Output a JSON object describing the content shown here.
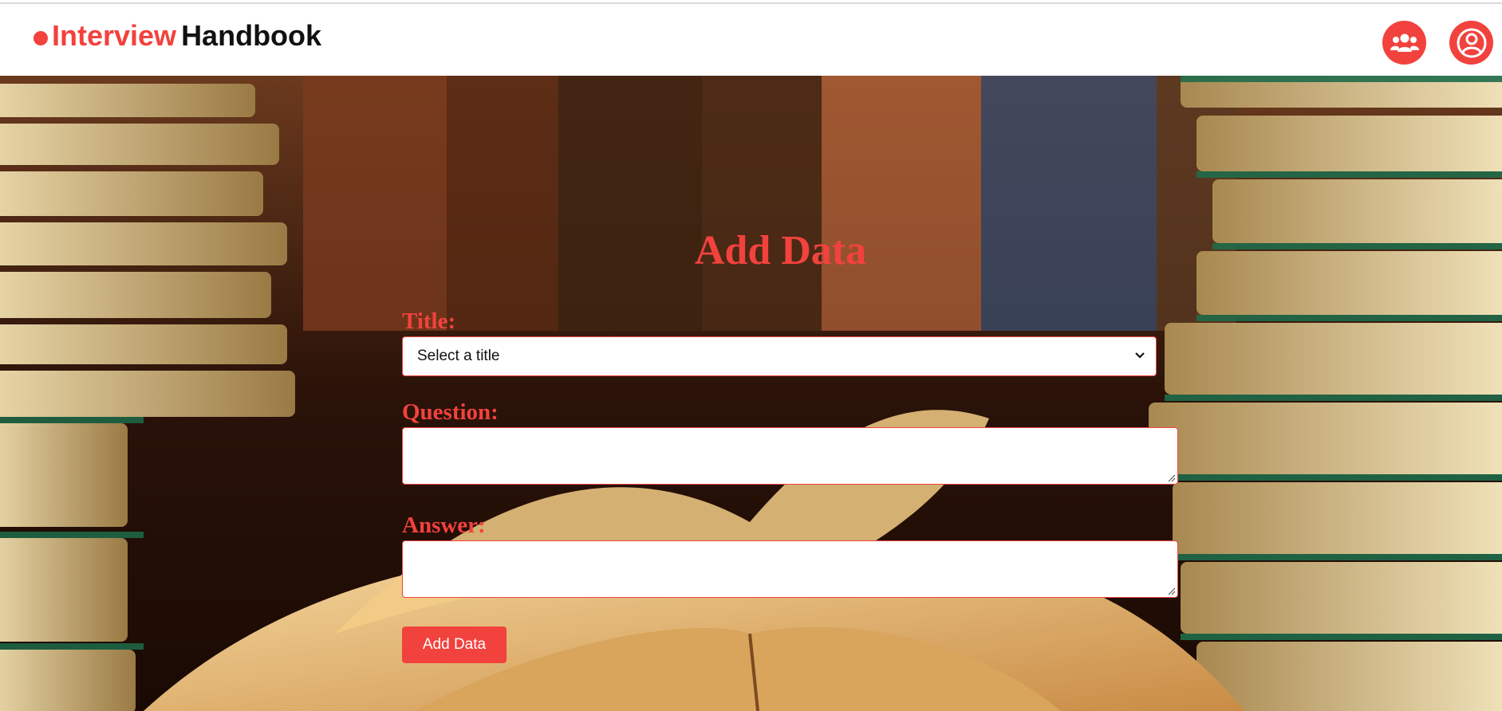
{
  "brand": {
    "part1": "Interview",
    "part2": "Handbook"
  },
  "nav": {
    "icons": [
      {
        "name": "users-group-icon"
      },
      {
        "name": "user-circle-icon"
      }
    ]
  },
  "form": {
    "heading": "Add Data",
    "title_label": "Title:",
    "title_select_value": "Select a title",
    "question_label": "Question:",
    "question_value": "",
    "answer_label": "Answer:",
    "answer_value": "",
    "submit_label": "Add Data"
  },
  "colors": {
    "accent": "#f2423d",
    "background_scene": "library bookshelves and open book"
  }
}
